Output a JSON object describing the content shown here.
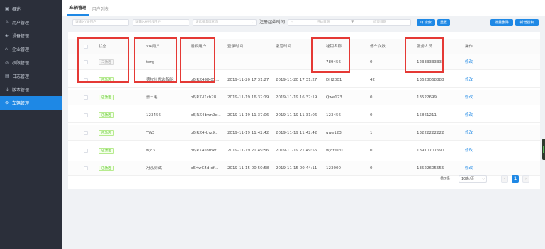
{
  "sidebar": {
    "items": [
      {
        "icon": "dashboard-icon",
        "glyph": "▣",
        "label": "概述",
        "active": false
      },
      {
        "icon": "user-icon",
        "glyph": "♙",
        "label": "用户管理",
        "active": false
      },
      {
        "icon": "device-icon",
        "glyph": "◈",
        "label": "设备管理",
        "active": false
      },
      {
        "icon": "company-icon",
        "glyph": "⌂",
        "label": "企业管理",
        "active": false
      },
      {
        "icon": "permission-icon",
        "glyph": "◎",
        "label": "权限管理",
        "active": false
      },
      {
        "icon": "log-icon",
        "glyph": "▤",
        "label": "日志管理",
        "active": false
      },
      {
        "icon": "version-icon",
        "glyph": "⇅",
        "label": "版本管理",
        "active": false
      },
      {
        "icon": "car-icon",
        "glyph": "⊜",
        "label": "车辆管理",
        "active": true
      }
    ]
  },
  "tabs": {
    "active": "车辆管理",
    "inactive": "用户列表",
    "sep": "|"
  },
  "filters": {
    "vip_placeholder": "请输入VIP用户",
    "auth_placeholder": "请输入被授权用户",
    "status_placeholder": "请选择车牌状态",
    "time_label": "注册起始时间",
    "start_placeholder": "开始日期",
    "range_sep": "至",
    "end_placeholder": "结束日期",
    "search_label": "Q 搜索",
    "reset_label": "重置",
    "batch_delete_label": "批量删除",
    "add_label": "新增授权"
  },
  "table": {
    "headers": {
      "status": "状态",
      "vip": "VIP用户",
      "auth": "授权用户",
      "login": "登录时间",
      "register": "激活时间",
      "plate": "秘钥名称",
      "count": "停车次数",
      "staff": "服务人员",
      "op": "操作"
    },
    "rows": [
      {
        "status": "未激活",
        "status_on": false,
        "vip": "feng",
        "auth": "",
        "login": "",
        "register": "",
        "plate": "789456",
        "count": "0",
        "staff": "12333333333",
        "op": "修改"
      },
      {
        "status": "已激活",
        "status_on": true,
        "vip": "德坎州优选智能",
        "auth": "o6jRX40lX0S...",
        "login": "2019-11-20 17:31:27",
        "register": "2019-11-20 17:31:27",
        "plate": "DH2001",
        "count": "42",
        "staff": "13628068888",
        "op": "修改"
      },
      {
        "status": "已激活",
        "status_on": true,
        "vip": "张三毛",
        "auth": "o6jRX-l1cb28...",
        "login": "2019-11-19 16:32:19",
        "register": "2019-11-19 16:32:19",
        "plate": "Qwe123",
        "count": "0",
        "staff": "13522699",
        "op": "修改"
      },
      {
        "status": "已激活",
        "status_on": true,
        "vip": "123456",
        "auth": "o6jRX4bwn9c...",
        "login": "2019-11-19 11:37:06",
        "register": "2019-11-19 11:31:06",
        "plate": "123456",
        "count": "0",
        "staff": "15861211",
        "op": "修改"
      },
      {
        "status": "已激活",
        "status_on": true,
        "vip": "TW3",
        "auth": "o6jRX4-Urz9...",
        "login": "2019-11-19 11:42:42",
        "register": "2019-11-19 11:42:42",
        "plate": "qwe123",
        "count": "1",
        "staff": "13222222222",
        "op": "修改"
      },
      {
        "status": "已激活",
        "status_on": true,
        "vip": "wjq3",
        "auth": "o6jRX4zomxt...",
        "login": "2019-11-19 21:49:56",
        "register": "2019-11-19 21:49:56",
        "plate": "wjqtest0",
        "count": "0",
        "staff": "13910707690",
        "op": "修改"
      },
      {
        "status": "已激活",
        "status_on": true,
        "vip": "冯泓测试",
        "auth": "o6HwC5d-df...",
        "login": "2019-11-15 00:50:58",
        "register": "2019-11-15 00:44:11",
        "plate": "123000",
        "count": "0",
        "staff": "13522605555",
        "op": "修改"
      }
    ]
  },
  "pagination": {
    "total": "共7条",
    "page_size": "10条/页",
    "prev": "‹",
    "current": "1",
    "next": "›"
  },
  "colors": {
    "accent": "#1e88e5",
    "highlight_box": "#e53935",
    "sidebar_bg": "#2b2f3a"
  }
}
